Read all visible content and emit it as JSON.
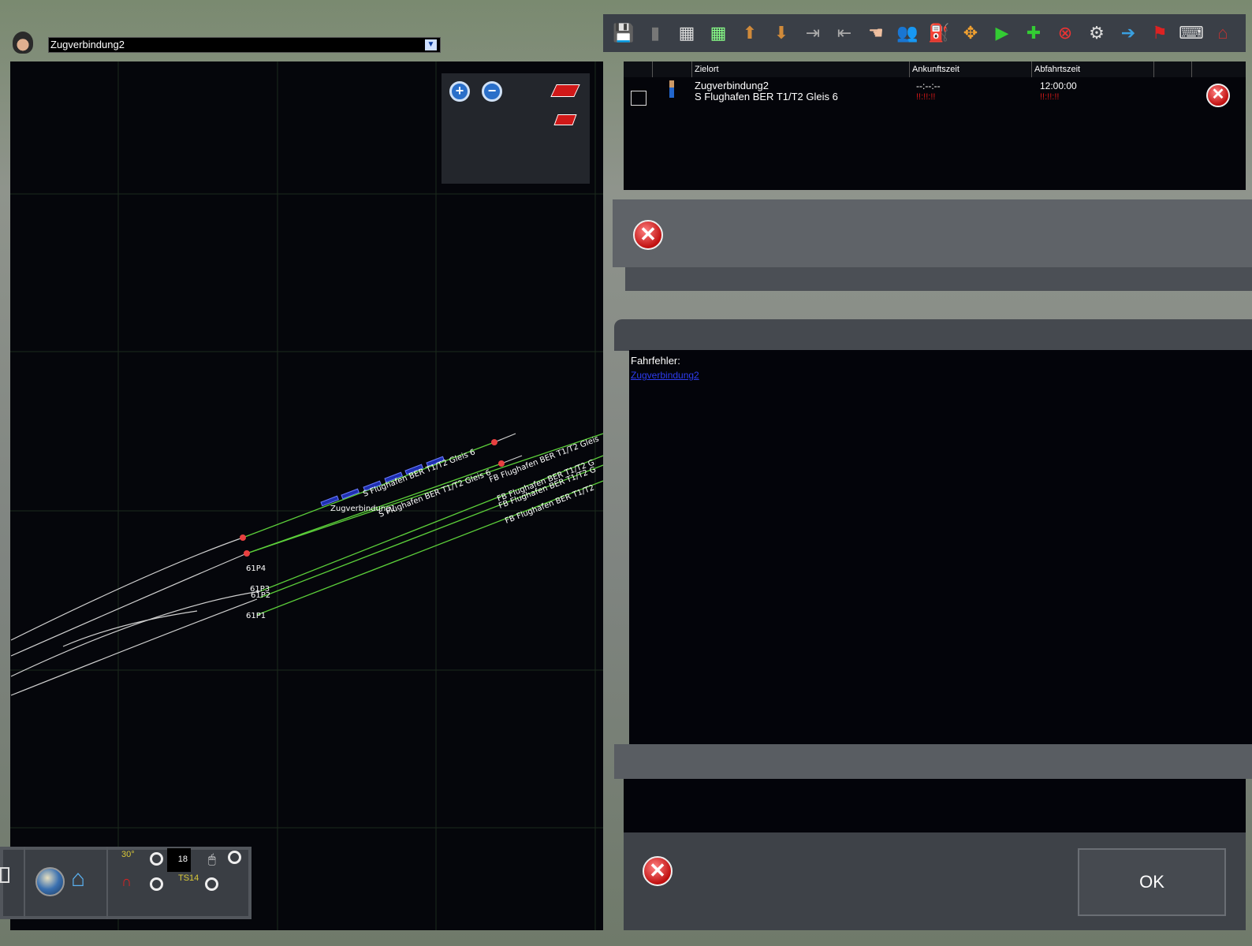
{
  "header": {
    "selected_service": "Zugverbindung2"
  },
  "map": {
    "track_labels": [
      "S Flughafen BER T1/T2 Gleis 6",
      "S Flughafen BER T1/T2 Gleis 6",
      "FB Flughafen BER T1/T2 Gleis",
      "FB Flughafen BER T1/T2 G",
      "FB Flughafen BER T1/T2 G",
      "FB Flughafen BER T1/T2"
    ],
    "train_label": "Zugverbindung1",
    "platform_labels": [
      "61P4",
      "61P3",
      "61P2",
      "61P1"
    ],
    "colors": {
      "track": "#5ccf3a",
      "rail": "#cfcfcf",
      "signal": "#e84040",
      "train": "#1e2fb0"
    }
  },
  "toolbar": {
    "icons": [
      "save-icon",
      "trash-icon",
      "grid-icon",
      "grid-green-icon",
      "move-up-icon",
      "move-down-icon",
      "insert-after-icon",
      "insert-before-icon",
      "pointer-hand-icon",
      "passengers-icon",
      "fuel-icon",
      "expand-icon",
      "add-instruction-icon",
      "add-icon",
      "remove-driver-icon",
      "settings-icon",
      "exit-icon",
      "flag-icon",
      "keyboard-icon",
      "station-icon"
    ]
  },
  "table": {
    "headers": [
      "Zielort",
      "Ankunftszeit",
      "Abfahrtszeit"
    ],
    "rows": [
      {
        "title": "Zugverbindung2",
        "destination": "S Flughafen BER T1/T2 Gleis 6",
        "arrival": "--:--:--",
        "arrival_status": "!!:!!:!!",
        "departure": "12:00:00",
        "departure_status": "!!:!!:!!"
      }
    ]
  },
  "errors": {
    "label": "Fahrfehler:",
    "link": "Zugverbindung2"
  },
  "bottom_toolbar": {
    "counter": "18",
    "ts_label": "TS14",
    "angle_label": "30°"
  },
  "dialog": {
    "ok_label": "OK"
  }
}
